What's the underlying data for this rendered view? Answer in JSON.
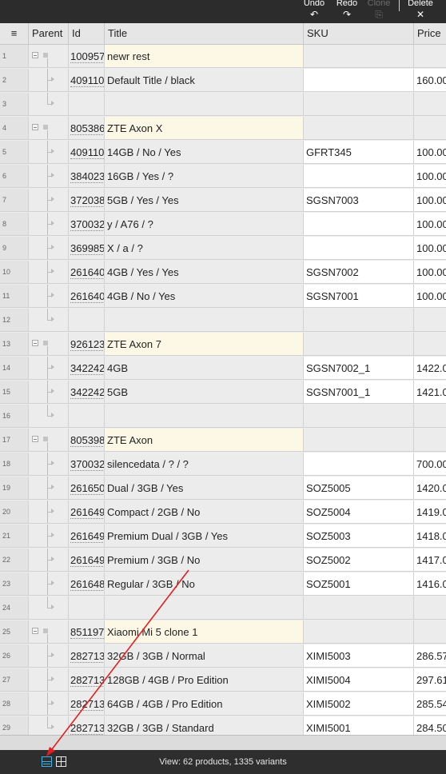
{
  "toolbar": {
    "undo_label": "Undo",
    "undo_icon": "undo-icon",
    "redo_label": "Redo",
    "redo_icon": "redo-icon",
    "clone_label": "Clone",
    "clone_icon": "clone-icon",
    "delete_label": "Delete",
    "delete_icon": "close-icon"
  },
  "columns": {
    "menu_icon": "≡",
    "parent": "Parent",
    "id": "Id",
    "title": "Title",
    "sku": "SKU",
    "price": "Price"
  },
  "rows": [
    {
      "n": "1",
      "kind": "parent",
      "id": "100957",
      "title": "newr rest",
      "sku": "",
      "price": ""
    },
    {
      "n": "2",
      "kind": "child",
      "id": "409110",
      "title": "Default Title / black",
      "sku": "",
      "price": "160.00"
    },
    {
      "n": "3",
      "kind": "empty",
      "id": "",
      "title": "",
      "sku": "",
      "price": ""
    },
    {
      "n": "4",
      "kind": "parent",
      "id": "805386",
      "title": "ZTE Axon X",
      "sku": "",
      "price": ""
    },
    {
      "n": "5",
      "kind": "child",
      "id": "409110",
      "title": "14GB / No / Yes",
      "sku": "GFRT345",
      "price": "100.00"
    },
    {
      "n": "6",
      "kind": "child",
      "id": "384023",
      "title": "16GB / Yes / ?",
      "sku": "",
      "price": "100.00"
    },
    {
      "n": "7",
      "kind": "child",
      "id": "372038",
      "title": "5GB / Yes / Yes",
      "sku": "SGSN7003",
      "price": "100.00"
    },
    {
      "n": "8",
      "kind": "child",
      "id": "370032",
      "title": "y / A76 / ?",
      "sku": "",
      "price": "100.00"
    },
    {
      "n": "9",
      "kind": "child",
      "id": "369985",
      "title": "X / a / ?",
      "sku": "",
      "price": "100.00"
    },
    {
      "n": "10",
      "kind": "child",
      "id": "261640",
      "title": "4GB / Yes / Yes",
      "sku": "SGSN7002",
      "price": "100.00"
    },
    {
      "n": "11",
      "kind": "child",
      "id": "261640",
      "title": "4GB / No / Yes",
      "sku": "SGSN7001",
      "price": "100.00"
    },
    {
      "n": "12",
      "kind": "empty",
      "id": "",
      "title": "",
      "sku": "",
      "price": ""
    },
    {
      "n": "13",
      "kind": "parent",
      "id": "926123",
      "title": "ZTE Axon 7",
      "sku": "",
      "price": ""
    },
    {
      "n": "14",
      "kind": "child",
      "id": "342242",
      "title": "4GB",
      "sku": "SGSN7002_1",
      "price": "1422.00"
    },
    {
      "n": "15",
      "kind": "child",
      "id": "342242",
      "title": "5GB",
      "sku": "SGSN7001_1",
      "price": "1421.00"
    },
    {
      "n": "16",
      "kind": "empty",
      "id": "",
      "title": "",
      "sku": "",
      "price": ""
    },
    {
      "n": "17",
      "kind": "parent",
      "id": "805398",
      "title": "ZTE Axon",
      "sku": "",
      "price": ""
    },
    {
      "n": "18",
      "kind": "child",
      "id": "370032",
      "title": "silencedata / ? / ?",
      "sku": "",
      "price": "700.00"
    },
    {
      "n": "19",
      "kind": "child",
      "id": "261650",
      "title": "Dual / 3GB / Yes",
      "sku": "SOZ5005",
      "price": "1420.00"
    },
    {
      "n": "20",
      "kind": "child",
      "id": "261649",
      "title": "Compact / 2GB / No",
      "sku": "SOZ5004",
      "price": "1419.00"
    },
    {
      "n": "21",
      "kind": "child",
      "id": "261649",
      "title": "Premium Dual / 3GB / Yes",
      "sku": "SOZ5003",
      "price": "1418.00"
    },
    {
      "n": "22",
      "kind": "child",
      "id": "261649",
      "title": "Premium / 3GB / No",
      "sku": "SOZ5002",
      "price": "1417.00"
    },
    {
      "n": "23",
      "kind": "child",
      "id": "261648",
      "title": "Regular / 3GB / No",
      "sku": "SOZ5001",
      "price": "1416.00"
    },
    {
      "n": "24",
      "kind": "empty",
      "id": "",
      "title": "",
      "sku": "",
      "price": ""
    },
    {
      "n": "25",
      "kind": "parent",
      "id": "851197",
      "title": "Xiaomi Mi 5 clone 1",
      "sku": "",
      "price": ""
    },
    {
      "n": "26",
      "kind": "child",
      "id": "282713",
      "title": "32GB / 3GB / Normal",
      "sku": "XIMI5003",
      "price": "286.57"
    },
    {
      "n": "27",
      "kind": "child",
      "id": "282713",
      "title": "128GB / 4GB / Pro Edition",
      "sku": "XIMI5004",
      "price": "297.61"
    },
    {
      "n": "28",
      "kind": "child",
      "id": "282713",
      "title": "64GB / 4GB / Pro Edition",
      "sku": "XIMI5002",
      "price": "285.54"
    },
    {
      "n": "29",
      "kind": "child",
      "id": "282713",
      "title": "32GB / 3GB / Standard",
      "sku": "XIMI5001",
      "price": "284.50"
    }
  ],
  "status": {
    "text": "View: 62 products, 1335 variants",
    "list_view_icon": "list-view-icon",
    "grid_view_icon": "grid-view-icon",
    "active_color": "#3fb3e8"
  },
  "annotation": {
    "arrow_color": "#e02020"
  }
}
